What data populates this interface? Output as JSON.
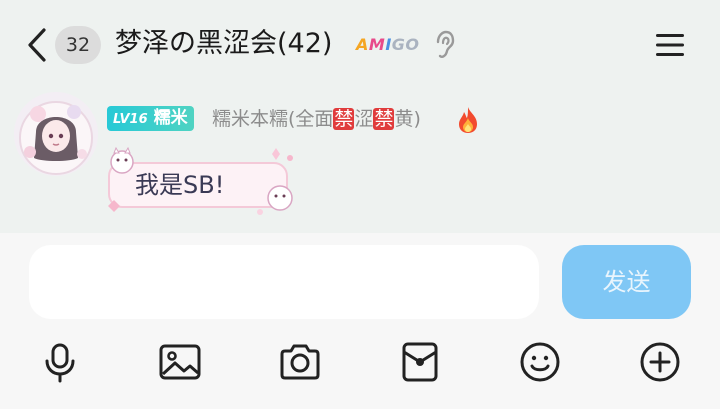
{
  "header": {
    "unread_count": "32",
    "title": "梦泽の黑涩会(42)",
    "badge_letters": [
      {
        "ch": "A",
        "color": "#f5a623"
      },
      {
        "ch": "M",
        "color": "#e84a8a"
      },
      {
        "ch": "I",
        "color": "#4a90e2"
      },
      {
        "ch": "G",
        "color": "#aab3c0"
      },
      {
        "ch": "O",
        "color": "#aab3c0"
      }
    ],
    "icons": [
      "back-arrow-icon",
      "ear-icon",
      "menu-icon"
    ]
  },
  "message": {
    "level": "LV16",
    "level_title": "糯米",
    "sender_parts": [
      "糯米本糯(全面",
      "禁",
      "涩",
      "禁",
      "黄)"
    ],
    "text": "我是SB!"
  },
  "composer": {
    "input_value": "",
    "send_label": "发送",
    "toolbar_icons": [
      "microphone-icon",
      "image-icon",
      "camera-icon",
      "red-packet-icon",
      "emoji-icon",
      "plus-icon"
    ]
  },
  "colors": {
    "chat_bg": "#eef2f0",
    "send_button": "#7fc7f5",
    "level_badge": "#27c9d6",
    "ban_badge": "#e03c3c"
  }
}
